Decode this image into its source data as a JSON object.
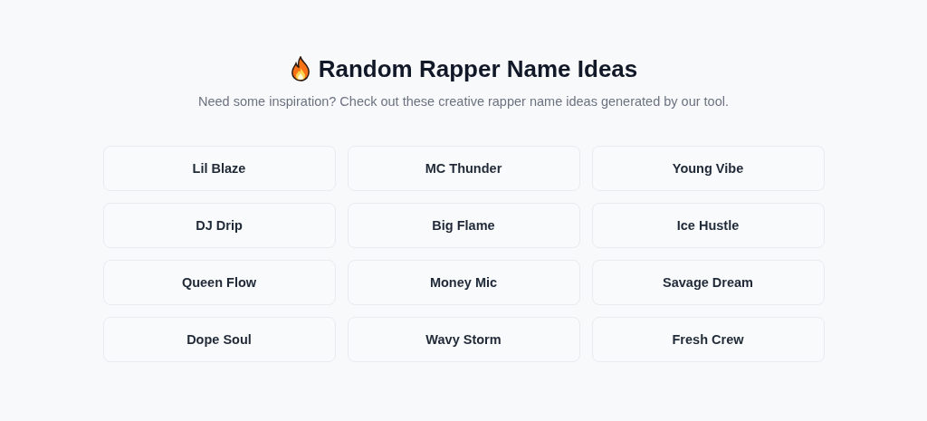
{
  "header": {
    "title": "Random Rapper Name Ideas",
    "subtitle": "Need some inspiration? Check out these creative rapper name ideas generated by our tool."
  },
  "names": [
    "Lil Blaze",
    "MC Thunder",
    "Young Vibe",
    "DJ Drip",
    "Big Flame",
    "Ice Hustle",
    "Queen Flow",
    "Money Mic",
    "Savage Dream",
    "Dope Soul",
    "Wavy Storm",
    "Fresh Crew"
  ]
}
